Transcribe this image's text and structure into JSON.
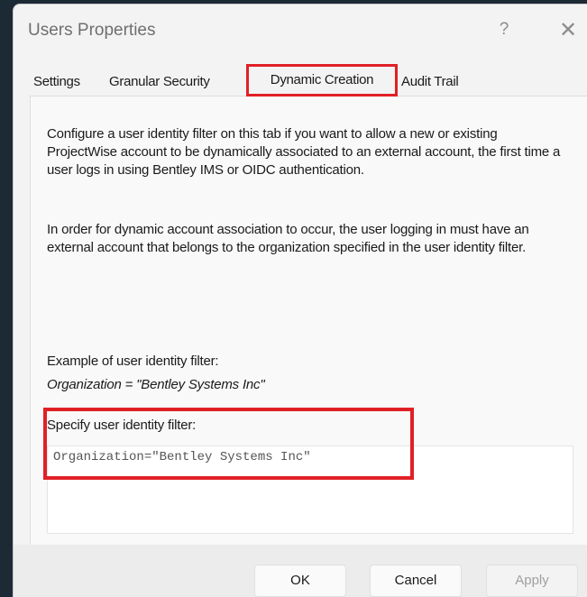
{
  "window": {
    "title": "Users Properties",
    "help_label": "?",
    "close_label": "✕"
  },
  "tabs": [
    {
      "label": "Settings"
    },
    {
      "label": "Granular Security"
    },
    {
      "label": "Dynamic Creation",
      "active": true
    },
    {
      "label": "Audit Trail"
    }
  ],
  "panel": {
    "paragraph1": "Configure a user identity filter on this tab if you want to allow a new or existing ProjectWise account to be dynamically associated to an external account, the first time a user logs in using Bentley IMS or OIDC authentication.",
    "paragraph2": "In order for dynamic account association to occur, the user logging in must have an external account that belongs to the organization specified in the user identity filter.",
    "example_label": "Example of user identity filter:",
    "example_value": "Organization = \"Bentley Systems Inc\"",
    "specify_label": "Specify user identity filter:",
    "filter_value": "Organization=\"Bentley Systems Inc\""
  },
  "buttons": {
    "ok": "OK",
    "cancel": "Cancel",
    "apply": "Apply"
  },
  "colors": {
    "highlight": "#e02026",
    "dialog_background": "#f3f3f3"
  }
}
